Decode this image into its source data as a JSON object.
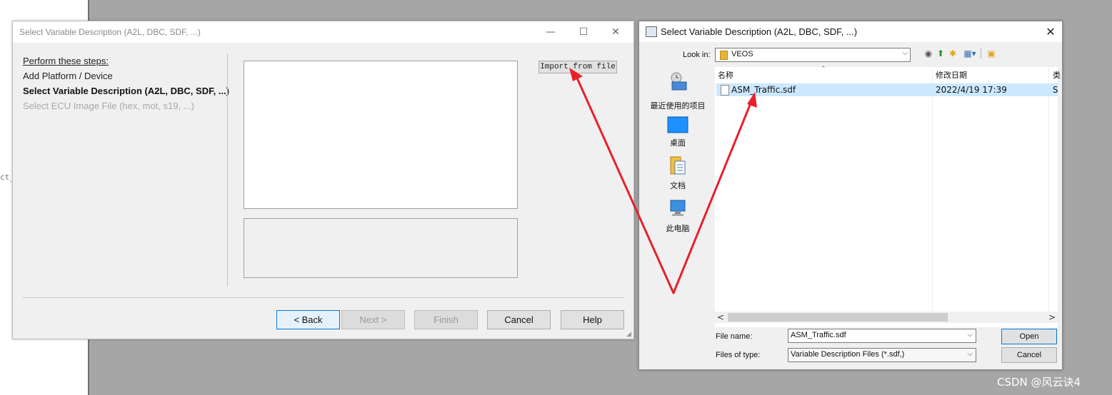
{
  "background": {
    "code_fragment": "ct_"
  },
  "wizard": {
    "title": "Select Variable Description (A2L, DBC, SDF, ...)",
    "controls": {
      "minimize": "—",
      "maximize": "☐",
      "close": "✕"
    },
    "steps": {
      "heading": "Perform these steps:",
      "items": [
        "Add Platform / Device",
        "Select Variable Description (A2L, DBC, SDF, ...)",
        "Select ECU Image File (hex, mot, s19, ...)"
      ]
    },
    "import_button": "Import from file",
    "buttons": {
      "back": "< Back",
      "next": "Next >",
      "finish": "Finish",
      "cancel": "Cancel",
      "help": "Help"
    }
  },
  "file_dialog": {
    "title": "Select Variable Description (A2L, DBC, SDF, ...)",
    "close": "✕",
    "look_in_label": "Look in:",
    "look_in_value": "VEOS",
    "places": [
      "最近使用的项目",
      "桌面",
      "文档",
      "此电脑"
    ],
    "columns": [
      "名称",
      "修改日期",
      "类"
    ],
    "files": [
      {
        "name": "ASM_Traffic.sdf",
        "date": "2022/4/19 17:39",
        "type": "S"
      }
    ],
    "scroll_left": "<",
    "scroll_right": ">",
    "file_name_label": "File name:",
    "file_name_value": "ASM_Traffic.sdf",
    "file_type_label": "Files of type:",
    "file_type_value": "Variable Description Files (*.sdf,)",
    "open_button": "Open",
    "cancel_button": "Cancel"
  },
  "watermark": "CSDN @风云诀4",
  "colors": {
    "annotation_arrow": "#e8202a",
    "selection": "#cce8ff",
    "focus_border": "#0078d7"
  }
}
